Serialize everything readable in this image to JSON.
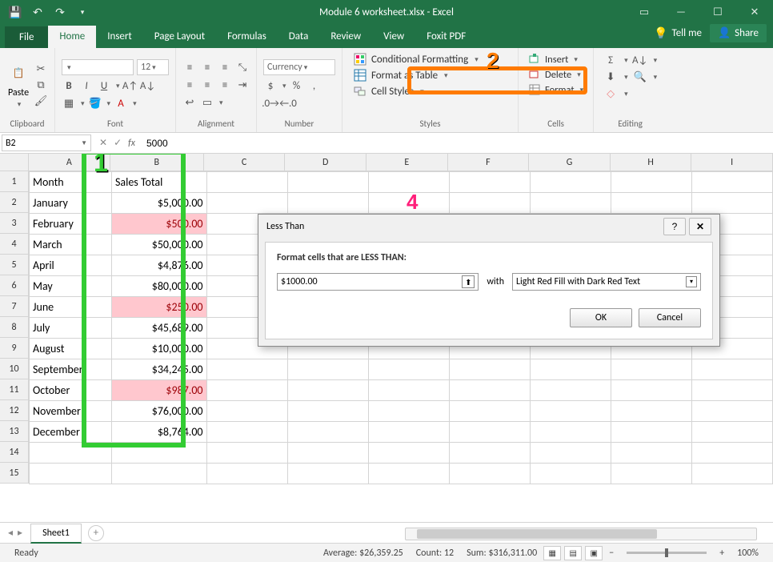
{
  "title": "Module 6 worksheet.xlsx - Excel",
  "tabs": {
    "file": "File",
    "home": "Home",
    "insert": "Insert",
    "pagelayout": "Page Layout",
    "formulas": "Formulas",
    "data": "Data",
    "review": "Review",
    "view": "View",
    "foxit": "Foxit PDF",
    "tellme": "Tell me",
    "share": "Share"
  },
  "ribbon": {
    "clipboard": {
      "label": "Clipboard",
      "paste": "Paste"
    },
    "font": {
      "label": "Font",
      "size": "12"
    },
    "alignment": {
      "label": "Alignment"
    },
    "number": {
      "label": "Number",
      "format": "Currency"
    },
    "styles": {
      "label": "Styles",
      "cond": "Conditional Formatting",
      "table": "Format as Table",
      "cell": "Cell Styles"
    },
    "cells": {
      "label": "Cells",
      "insert": "Insert",
      "delete": "Delete",
      "format": "Format"
    },
    "editing": {
      "label": "Editing"
    }
  },
  "namebox": "B2",
  "formula": "5000",
  "columns": [
    "A",
    "B",
    "C",
    "D",
    "E",
    "F",
    "G",
    "H",
    "I"
  ],
  "rows": [
    {
      "n": 1,
      "a": "Month",
      "b": "Sales Total",
      "hl": false
    },
    {
      "n": 2,
      "a": "January",
      "b": "$5,000.00",
      "hl": false
    },
    {
      "n": 3,
      "a": "February",
      "b": "$500.00",
      "hl": true
    },
    {
      "n": 4,
      "a": "March",
      "b": "$50,000.00",
      "hl": false
    },
    {
      "n": 5,
      "a": "April",
      "b": "$4,876.00",
      "hl": false
    },
    {
      "n": 6,
      "a": "May",
      "b": "$80,000.00",
      "hl": false
    },
    {
      "n": 7,
      "a": "June",
      "b": "$250.00",
      "hl": true
    },
    {
      "n": 8,
      "a": "July",
      "b": "$45,689.00",
      "hl": false
    },
    {
      "n": 9,
      "a": "August",
      "b": "$10,000.00",
      "hl": false
    },
    {
      "n": 10,
      "a": "September",
      "b": "$34,245.00",
      "hl": false
    },
    {
      "n": 11,
      "a": "October",
      "b": "$987.00",
      "hl": true
    },
    {
      "n": 12,
      "a": "November",
      "b": "$76,000.00",
      "hl": false
    },
    {
      "n": 13,
      "a": "December",
      "b": "$8,764.00",
      "hl": false
    },
    {
      "n": 14,
      "a": "",
      "b": "",
      "hl": false
    },
    {
      "n": 15,
      "a": "",
      "b": "",
      "hl": false
    }
  ],
  "annotations": {
    "one": "1",
    "two": "2",
    "four": "4"
  },
  "dialog": {
    "title": "Less Than",
    "label": "Format cells that are LESS THAN:",
    "value": "$1000.00",
    "with": "with",
    "fillOption": "Light Red Fill with Dark Red Text",
    "ok": "OK",
    "cancel": "Cancel"
  },
  "sheet": {
    "name": "Sheet1"
  },
  "status": {
    "ready": "Ready",
    "avg": "Average: $26,359.25",
    "count": "Count: 12",
    "sum": "Sum: $316,311.00",
    "zoom": "100%"
  }
}
